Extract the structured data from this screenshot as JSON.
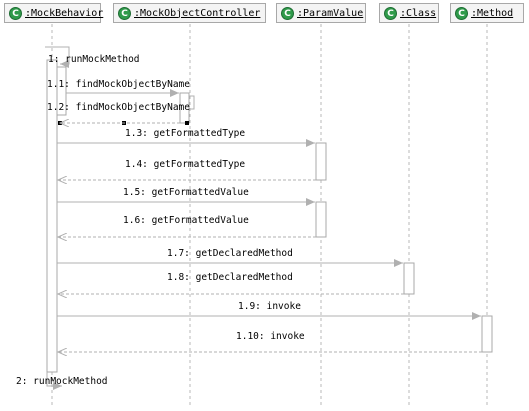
{
  "lifelines": [
    {
      "id": "mb",
      "label": ":MockBehavior",
      "icon": "class-c-icon"
    },
    {
      "id": "moc",
      "label": ":MockObjectController",
      "icon": "class-c-icon"
    },
    {
      "id": "pv",
      "label": ":ParamValue",
      "icon": "class-c-icon"
    },
    {
      "id": "cls",
      "label": ":Class",
      "icon": "class-c-icon"
    },
    {
      "id": "mth",
      "label": ":Method",
      "icon": "class-c-icon"
    }
  ],
  "icon_letter": "C",
  "messages": [
    {
      "label": "1: runMockMethod"
    },
    {
      "label": "1.1: findMockObjectByName"
    },
    {
      "label": "1.2: findMockObjectByName"
    },
    {
      "label": "1.3: getFormattedType"
    },
    {
      "label": "1.4: getFormattedType"
    },
    {
      "label": "1.5: getFormattedValue"
    },
    {
      "label": "1.6: getFormattedValue"
    },
    {
      "label": "1.7: getDeclaredMethod"
    },
    {
      "label": "1.8: getDeclaredMethod"
    },
    {
      "label": "1.9: invoke"
    },
    {
      "label": "1.10: invoke"
    },
    {
      "label": "2: runMockMethod"
    }
  ],
  "colors": {
    "icon_green": "#2f9a4a",
    "line_gray": "#a8a8a8",
    "header_bg": "#f4f4f4"
  }
}
